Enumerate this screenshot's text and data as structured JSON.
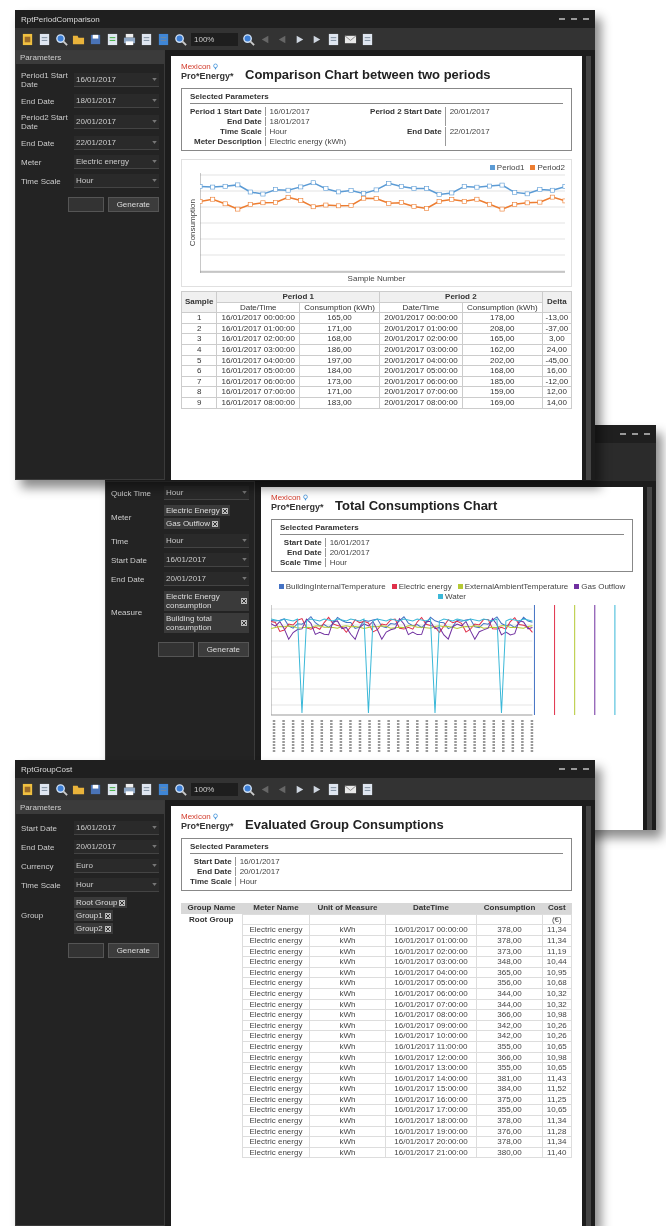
{
  "windows": [
    {
      "kind": "comparison",
      "title": "RptPeriodComparison",
      "zoom": "100%",
      "panel_title": "Parameters",
      "params": [
        {
          "kind": "dropdown",
          "label": "Period1 Start Date",
          "values": [
            "16/01/2017"
          ]
        },
        {
          "kind": "dropdown",
          "label": "End Date",
          "values": [
            "18/01/2017"
          ]
        },
        {
          "kind": "dropdown",
          "label": "Period2 Start Date",
          "values": [
            "20/01/2017"
          ]
        },
        {
          "kind": "dropdown",
          "label": "End Date",
          "values": [
            "22/01/2017"
          ]
        },
        {
          "kind": "dropdown",
          "label": "Meter",
          "values": [
            "Electric energy"
          ]
        },
        {
          "kind": "dropdown",
          "label": "Time Scale",
          "values": [
            "Hour"
          ]
        }
      ],
      "buttons": [
        "Generate"
      ],
      "report": {
        "logo_top": "Mexicon",
        "logo_bottom": "Pro*Energy*",
        "title": "Comparison Chart between two periods",
        "section": "Selected Parameters",
        "params": [
          {
            "label": "Period 1 Start Date",
            "value": "16/01/2017"
          },
          {
            "label": "End Date",
            "value": "18/01/2017"
          },
          {
            "label": "Time Scale",
            "value": "Hour"
          },
          {
            "label": "Meter Description",
            "value": "Electric energy (kWh)"
          }
        ],
        "params_right": [
          {
            "label": "Period 2 Start Date",
            "value": "20/01/2017"
          },
          {
            "label": "End Date",
            "value": "22/01/2017"
          }
        ],
        "legend": [
          {
            "name": "Period1",
            "color": "#5b9bd5"
          },
          {
            "name": "Period2",
            "color": "#ed7d31"
          }
        ],
        "ylabel": "Consumption",
        "xlabel": "Sample Number",
        "table": {
          "groups": [
            "Sample",
            "Period 1",
            "Period 2",
            "Delta"
          ],
          "subheads": [
            "Date/Time",
            "Consumption (kWh)",
            "Date/Time",
            "Consumption (kWh)"
          ],
          "rows": [
            [
              "1",
              "16/01/2017 00:00:00",
              "165,00",
              "20/01/2017 00:00:00",
              "178,00",
              "-13,00"
            ],
            [
              "2",
              "16/01/2017 01:00:00",
              "171,00",
              "20/01/2017 01:00:00",
              "208,00",
              "-37,00"
            ],
            [
              "3",
              "16/01/2017 02:00:00",
              "168,00",
              "20/01/2017 02:00:00",
              "165,00",
              "3,00"
            ],
            [
              "4",
              "16/01/2017 03:00:00",
              "186,00",
              "20/01/2017 03:00:00",
              "162,00",
              "24,00"
            ],
            [
              "5",
              "16/01/2017 04:00:00",
              "197,00",
              "20/01/2017 04:00:00",
              "202,00",
              "-45,00"
            ],
            [
              "6",
              "16/01/2017 05:00:00",
              "184,00",
              "20/01/2017 05:00:00",
              "168,00",
              "16,00"
            ],
            [
              "7",
              "16/01/2017 06:00:00",
              "173,00",
              "20/01/2017 06:00:00",
              "185,00",
              "-12,00"
            ],
            [
              "8",
              "16/01/2017 07:00:00",
              "171,00",
              "20/01/2017 07:00:00",
              "159,00",
              "12,00"
            ],
            [
              "9",
              "16/01/2017 08:00:00",
              "183,00",
              "20/01/2017 08:00:00",
              "169,00",
              "14,00"
            ]
          ]
        }
      }
    },
    {
      "kind": "total",
      "params": [
        {
          "kind": "dropdown",
          "label": "Quick Time",
          "values": [
            "Hour"
          ]
        },
        {
          "kind": "chips",
          "label": "Meter",
          "values": [
            "Electric Energy",
            "Gas Outflow"
          ]
        },
        {
          "kind": "dropdown",
          "label": "Time",
          "values": [
            "Hour"
          ]
        },
        {
          "kind": "dropdown",
          "label": "Start Date",
          "values": [
            "16/01/2017"
          ]
        },
        {
          "kind": "dropdown",
          "label": "End Date",
          "values": [
            "20/01/2017"
          ]
        },
        {
          "kind": "chips",
          "label": "Measure",
          "values": [
            "Electric Energy consumption",
            "Building total consumption"
          ]
        }
      ],
      "buttons": [
        "Generate"
      ],
      "report": {
        "logo_top": "Mexicon",
        "logo_bottom": "Pro*Energy*",
        "title": "Total Consumptions Chart",
        "section": "Selected Parameters",
        "params": [
          {
            "label": "Start Date",
            "value": "16/01/2017"
          },
          {
            "label": "End Date",
            "value": "20/01/2017"
          },
          {
            "label": "Scale Time",
            "value": "Hour"
          }
        ],
        "legend": [
          {
            "name": "BuildingInternalTemperature",
            "color": "#4472c4"
          },
          {
            "name": "Electric energy",
            "color": "#e0304a"
          },
          {
            "name": "ExternalAmbientTemperature",
            "color": "#b5c934"
          },
          {
            "name": "Gas Outflow",
            "color": "#7030a0"
          },
          {
            "name": "Water",
            "color": "#3bb8d8"
          }
        ]
      }
    },
    {
      "kind": "group",
      "title": "RptGroupCost",
      "zoom": "100%",
      "panel_title": "Parameters",
      "params": [
        {
          "kind": "dropdown",
          "label": "Start Date",
          "values": [
            "16/01/2017"
          ]
        },
        {
          "kind": "dropdown",
          "label": "End Date",
          "values": [
            "20/01/2017"
          ]
        },
        {
          "kind": "dropdown",
          "label": "Currency",
          "values": [
            "Euro"
          ]
        },
        {
          "kind": "dropdown",
          "label": "Time Scale",
          "values": [
            "Hour"
          ]
        },
        {
          "kind": "chips",
          "label": "Group",
          "values": [
            "Root Group",
            "Group1",
            "Group2"
          ]
        }
      ],
      "buttons": [
        "Generate"
      ],
      "report": {
        "logo_top": "Mexicon",
        "logo_bottom": "Pro*Energy*",
        "title": "Evaluated Group Consumptions",
        "section": "Selected Parameters",
        "params": [
          {
            "label": "Start Date",
            "value": "16/01/2017"
          },
          {
            "label": "End Date",
            "value": "20/01/2017"
          },
          {
            "label": "Time Scale",
            "value": "Hour"
          }
        ],
        "table": {
          "columns": [
            "Group Name",
            "Meter Name",
            "Unit of Measure",
            "DateTime",
            "Consumption",
            "Cost"
          ],
          "rows": [
            [
              "Root Group",
              "",
              "",
              "",
              "",
              "(€)"
            ],
            [
              "",
              "Electric energy",
              "kWh",
              "16/01/2017 00:00:00",
              "378,00",
              "11,34"
            ],
            [
              "",
              "Electric energy",
              "kWh",
              "16/01/2017 01:00:00",
              "378,00",
              "11,34"
            ],
            [
              "",
              "Electric energy",
              "kWh",
              "16/01/2017 02:00:00",
              "373,00",
              "11,19"
            ],
            [
              "",
              "Electric energy",
              "kWh",
              "16/01/2017 03:00:00",
              "348,00",
              "10,44"
            ],
            [
              "",
              "Electric energy",
              "kWh",
              "16/01/2017 04:00:00",
              "365,00",
              "10,95"
            ],
            [
              "",
              "Electric energy",
              "kWh",
              "16/01/2017 05:00:00",
              "356,00",
              "10,68"
            ],
            [
              "",
              "Electric energy",
              "kWh",
              "16/01/2017 06:00:00",
              "344,00",
              "10,32"
            ],
            [
              "",
              "Electric energy",
              "kWh",
              "16/01/2017 07:00:00",
              "344,00",
              "10,32"
            ],
            [
              "",
              "Electric energy",
              "kWh",
              "16/01/2017 08:00:00",
              "366,00",
              "10,98"
            ],
            [
              "",
              "Electric energy",
              "kWh",
              "16/01/2017 09:00:00",
              "342,00",
              "10,26"
            ],
            [
              "",
              "Electric energy",
              "kWh",
              "16/01/2017 10:00:00",
              "342,00",
              "10,26"
            ],
            [
              "",
              "Electric energy",
              "kWh",
              "16/01/2017 11:00:00",
              "355,00",
              "10,65"
            ],
            [
              "",
              "Electric energy",
              "kWh",
              "16/01/2017 12:00:00",
              "366,00",
              "10,98"
            ],
            [
              "",
              "Electric energy",
              "kWh",
              "16/01/2017 13:00:00",
              "355,00",
              "10,65"
            ],
            [
              "",
              "Electric energy",
              "kWh",
              "16/01/2017 14:00:00",
              "381,00",
              "11,43"
            ],
            [
              "",
              "Electric energy",
              "kWh",
              "16/01/2017 15:00:00",
              "384,00",
              "11,52"
            ],
            [
              "",
              "Electric energy",
              "kWh",
              "16/01/2017 16:00:00",
              "375,00",
              "11,25"
            ],
            [
              "",
              "Electric energy",
              "kWh",
              "16/01/2017 17:00:00",
              "355,00",
              "10,65"
            ],
            [
              "",
              "Electric energy",
              "kWh",
              "16/01/2017 18:00:00",
              "378,00",
              "11,34"
            ],
            [
              "",
              "Electric energy",
              "kWh",
              "16/01/2017 19:00:00",
              "376,00",
              "11,28"
            ],
            [
              "",
              "Electric energy",
              "kWh",
              "16/01/2017 20:00:00",
              "378,00",
              "11,34"
            ],
            [
              "",
              "Electric energy",
              "kWh",
              "16/01/2017 21:00:00",
              "380,00",
              "11,40"
            ]
          ]
        }
      }
    }
  ]
}
